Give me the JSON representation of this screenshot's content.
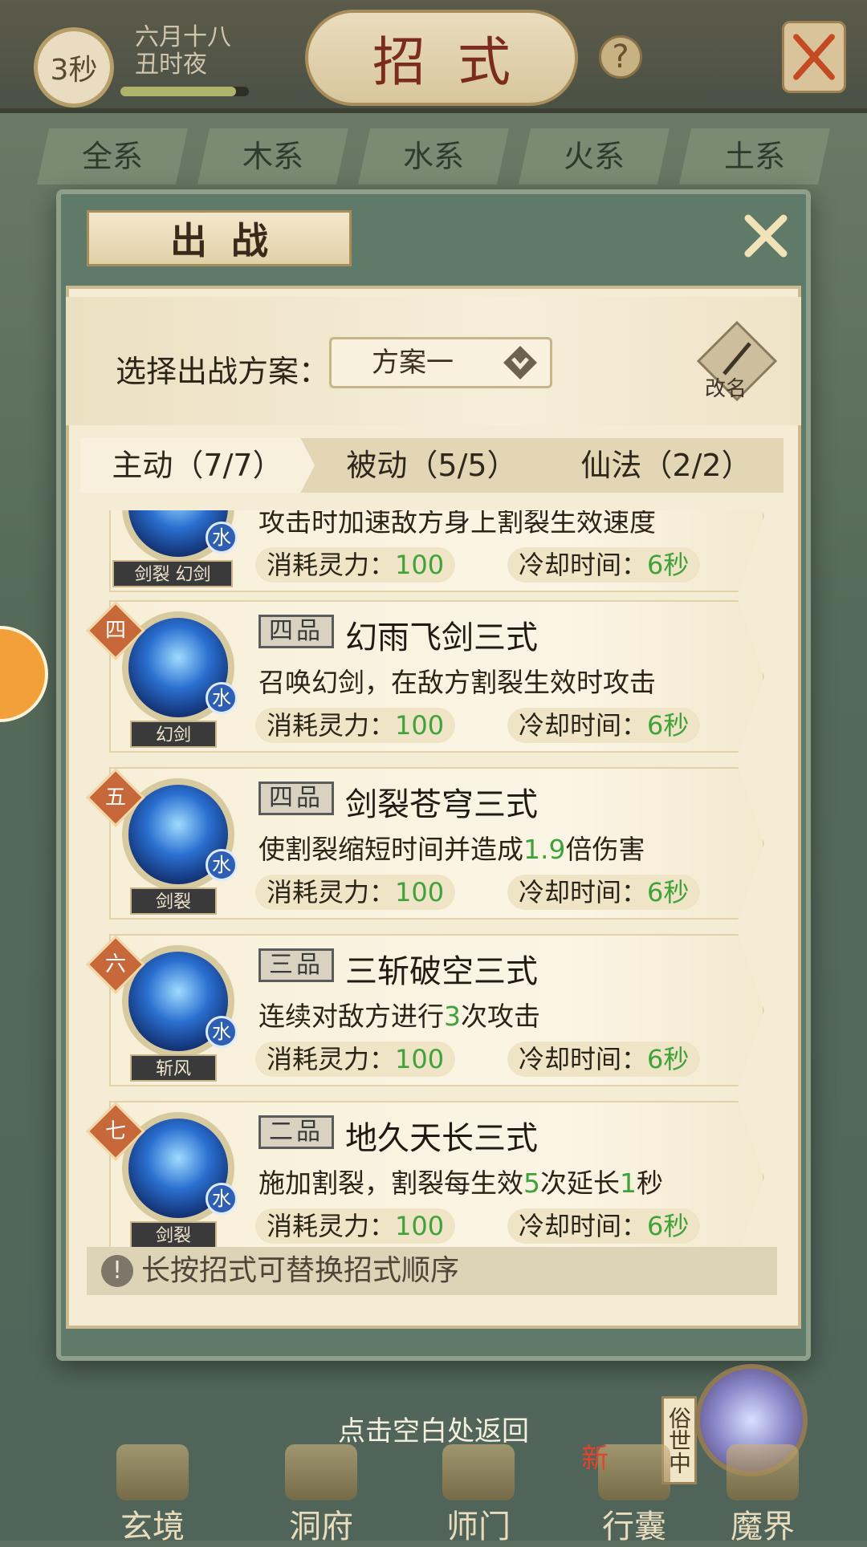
{
  "topbar": {
    "timer": "3秒",
    "date_line1": "六月十八",
    "date_line2": "丑时夜",
    "time_progress": 0.9,
    "title": "招式"
  },
  "element_tabs": [
    "全系",
    "木系",
    "水系",
    "火系",
    "土系"
  ],
  "modal": {
    "title": "出战",
    "scheme_label": "选择出战方案：",
    "scheme_value": "方案一",
    "rename_label": "改名",
    "tabs": [
      {
        "label": "主动（7/7）",
        "active": true
      },
      {
        "label": "被动（5/5）",
        "active": false
      },
      {
        "label": "仙法（2/2）",
        "active": false
      }
    ],
    "cards": [
      {
        "rank": "",
        "grade": "",
        "name": "",
        "desc": "攻击时加速敌方身上割裂生效速度",
        "tag": "剑裂 幻剑",
        "element": "水",
        "cost_label": "消耗灵力：",
        "cost": "100",
        "cd_label": "冷却时间：",
        "cd": "6秒"
      },
      {
        "rank": "四",
        "grade": "四品",
        "name": "幻雨飞剑三式",
        "desc": "召唤幻剑，在敌方割裂生效时攻击",
        "tag": "幻剑",
        "element": "水",
        "cost_label": "消耗灵力：",
        "cost": "100",
        "cd_label": "冷却时间：",
        "cd": "6秒"
      },
      {
        "rank": "五",
        "grade": "四品",
        "name": "剑裂苍穹三式",
        "desc_pre": "使割裂缩短时间并造成",
        "desc_num": "1.9",
        "desc_post": "倍伤害",
        "tag": "剑裂",
        "element": "水",
        "cost_label": "消耗灵力：",
        "cost": "100",
        "cd_label": "冷却时间：",
        "cd": "6秒"
      },
      {
        "rank": "六",
        "grade": "三品",
        "name": "三斩破空三式",
        "desc_pre": "连续对敌方进行",
        "desc_num": "3",
        "desc_post": "次攻击",
        "tag": "斩风",
        "element": "水",
        "cost_label": "消耗灵力：",
        "cost": "100",
        "cd_label": "冷却时间：",
        "cd": "6秒"
      },
      {
        "rank": "七",
        "grade": "二品",
        "name": "地久天长三式",
        "desc_pre": "施加割裂，割裂每生效",
        "desc_num": "5",
        "desc_mid": "次延长",
        "desc_num2": "1",
        "desc_post": "秒",
        "tag": "剑裂",
        "element": "水",
        "cost_label": "消耗灵力：",
        "cost": "100",
        "cd_label": "冷却时间：",
        "cd": "6秒"
      }
    ],
    "tip": "长按招式可替换招式顺序"
  },
  "return_hint": "点击空白处返回",
  "bottom_nav": [
    {
      "label": "玄境",
      "icon": "scroll-icon"
    },
    {
      "label": "洞府",
      "icon": "cave-icon"
    },
    {
      "label": "师门",
      "icon": "sect-icon"
    },
    {
      "label": "行囊",
      "icon": "bag-icon"
    },
    {
      "label": "魔界",
      "icon": "demon-icon"
    }
  ],
  "side_badge": "俗世中",
  "new_badge": "新",
  "colors": {
    "accent_green": "#3fa23a",
    "title_red": "#7a2d1c",
    "rank_orange": "#c7683a",
    "water_blue": "#2e5fb0"
  }
}
